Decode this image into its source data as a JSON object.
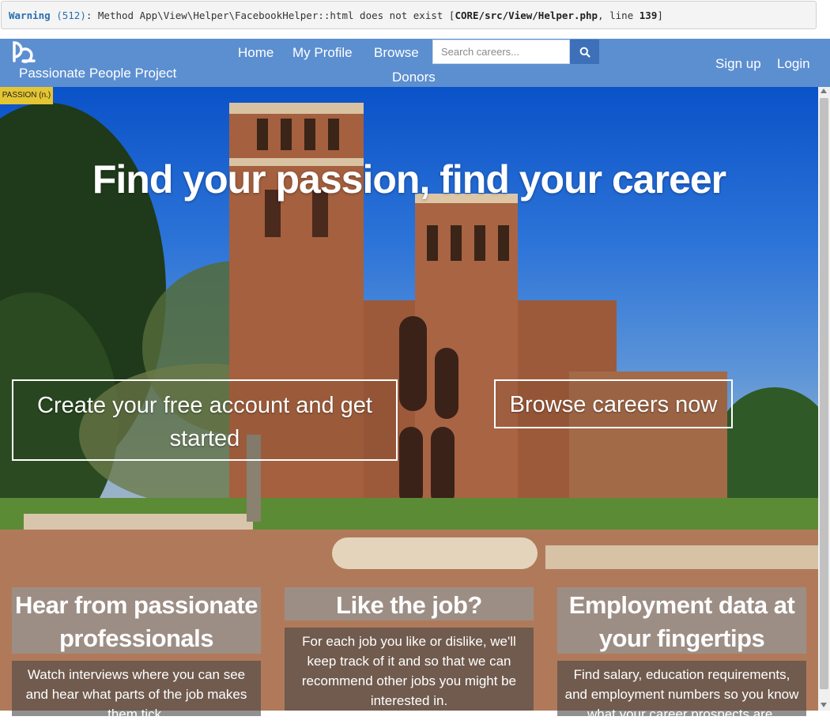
{
  "warning": {
    "level": "Warning",
    "code": "(512)",
    "message": ": Method App\\View\\Helper\\FacebookHelper::html does not exist [",
    "file": "CORE/src/View/Helper.php",
    "line_prefix": ", line ",
    "line": "139",
    "suffix": "]"
  },
  "navbar": {
    "brand": "Passionate People Project",
    "links": [
      "Home",
      "My Profile",
      "Browse",
      "Donors"
    ],
    "search_placeholder": "Search careers...",
    "sign_up": "Sign up",
    "login": "Login"
  },
  "hero": {
    "passion_tag": "PASSION (n.)",
    "title": "Find your passion, find your career",
    "cta_create": "Create your free account and get started",
    "cta_browse": "Browse careers now"
  },
  "features": [
    {
      "title": "Hear from passionate professionals",
      "body": "Watch interviews where you can see and hear what parts of the job makes them tick."
    },
    {
      "title": "Like the job?",
      "body": "For each job you like or dislike, we'll keep track of it and so that we can recommend other jobs you might be interested in."
    },
    {
      "title": "Employment data at your fingertips",
      "body": "Find salary, education requirements, and employment numbers so you know what your career prospects are."
    }
  ],
  "colors": {
    "navbar": "#5c8fd0",
    "search_button": "#3d70b8",
    "passion_tag": "#e4c532"
  }
}
